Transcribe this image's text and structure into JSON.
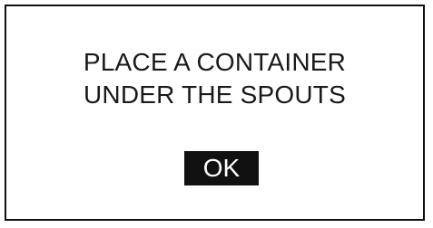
{
  "dialog": {
    "message_line1": "PLACE A CONTAINER",
    "message_line2": "UNDER THE SPOUTS",
    "ok_label": "OK"
  },
  "colors": {
    "background": "#ffffff",
    "border": "#111111",
    "text": "#1a1a1a",
    "button_bg": "#111111",
    "button_text": "#ffffff"
  }
}
